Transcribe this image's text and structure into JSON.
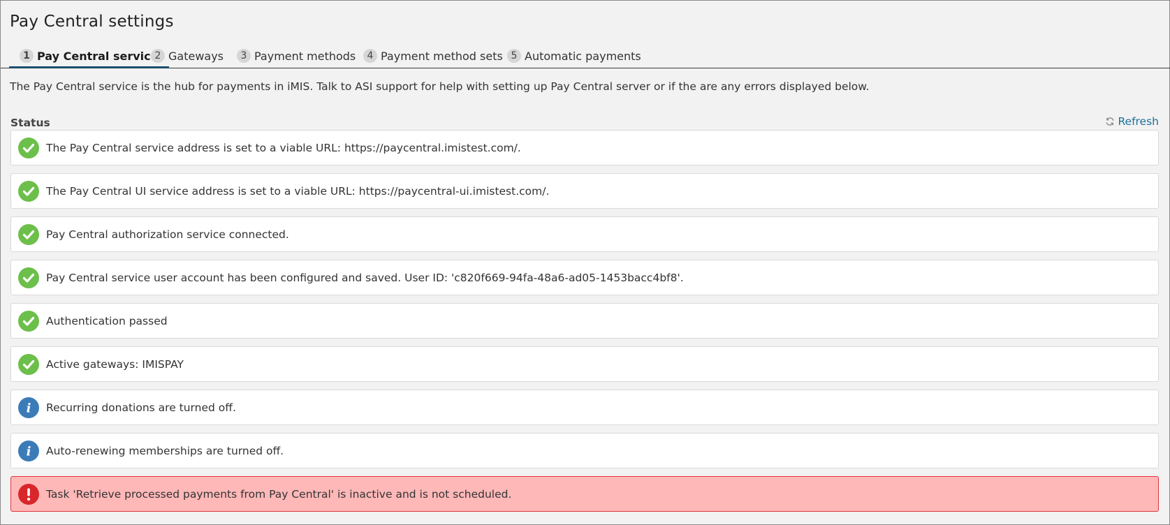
{
  "page": {
    "title": "Pay Central settings"
  },
  "tabs": [
    {
      "num": "1",
      "label": "Pay Central service"
    },
    {
      "num": "2",
      "label": "Gateways"
    },
    {
      "num": "3",
      "label": "Payment methods"
    },
    {
      "num": "4",
      "label": "Payment method sets"
    },
    {
      "num": "5",
      "label": "Automatic payments"
    }
  ],
  "intro": "The Pay Central service is the hub for payments in iMIS. Talk to ASI support for help with setting up Pay Central server or if the are any errors displayed below.",
  "status": {
    "label": "Status",
    "refresh_label": "Refresh",
    "items": [
      {
        "type": "success",
        "icon": "check-circle-icon",
        "text": "The Pay Central service address is set to a viable URL: https://paycentral.imistest.com/."
      },
      {
        "type": "success",
        "icon": "check-circle-icon",
        "text": "The Pay Central UI service address is set to a viable URL: https://paycentral-ui.imistest.com/."
      },
      {
        "type": "success",
        "icon": "check-circle-icon",
        "text": "Pay Central authorization service connected."
      },
      {
        "type": "success",
        "icon": "check-circle-icon",
        "text": "Pay Central service user account has been configured and saved. User ID: 'c820f669-94fa-48a6-ad05-1453bacc4bf8'."
      },
      {
        "type": "success",
        "icon": "check-circle-icon",
        "text": "Authentication passed"
      },
      {
        "type": "success",
        "icon": "check-circle-icon",
        "text": "Active gateways: IMISPAY"
      },
      {
        "type": "info",
        "icon": "info-circle-icon",
        "text": "Recurring donations are turned off."
      },
      {
        "type": "info",
        "icon": "info-circle-icon",
        "text": "Auto-renewing memberships are turned off."
      },
      {
        "type": "error",
        "icon": "exclamation-circle-icon",
        "text": "Task 'Retrieve processed payments from Pay Central' is inactive and is not scheduled."
      }
    ]
  },
  "colors": {
    "success": "#6cbf4a",
    "info": "#3b7bb8",
    "error": "#d9262b",
    "error_bg": "#ffb8b8",
    "tab_underline": "#1b4e6b",
    "link": "#1f6f99"
  }
}
